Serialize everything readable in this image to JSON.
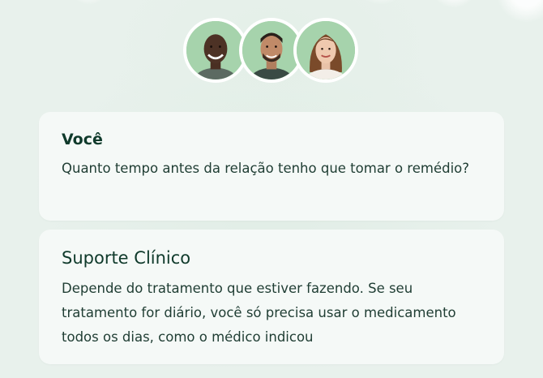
{
  "chat": {
    "messages": [
      {
        "sender": "Você",
        "text": "Quanto tempo antes da relação tenho que tomar o remédio?"
      },
      {
        "sender": "Suporte Clínico",
        "text": "Depende do tratamento que estiver fazendo. Se seu tratamento for diário, você só precisa usar o medicamento todos os dias, como o médico indicou"
      }
    ]
  },
  "colors": {
    "background": "#e8f1ec",
    "card": "#f5f9f7",
    "heading": "#0f3a2b",
    "text": "#1f3d33",
    "avatar_bg": "#9fd0a6"
  }
}
